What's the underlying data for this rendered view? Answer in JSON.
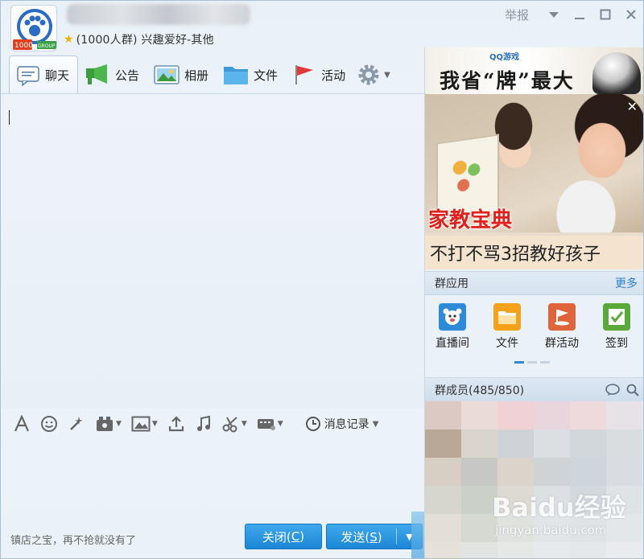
{
  "header": {
    "subtitle": "(1000人群) 兴趣爱好-其他",
    "report_label": "举报",
    "avatar_badge": "1000",
    "avatar_ribbon": "GROUP"
  },
  "tabs": [
    {
      "label": "聊天",
      "icon": "chat-bubble-icon",
      "active": true
    },
    {
      "label": "公告",
      "icon": "megaphone-icon",
      "active": false
    },
    {
      "label": "相册",
      "icon": "photo-icon",
      "active": false
    },
    {
      "label": "文件",
      "icon": "folder-icon",
      "active": false
    },
    {
      "label": "活动",
      "icon": "flag-icon",
      "active": false
    }
  ],
  "toolbar": {
    "history_label": "消息记录"
  },
  "footer": {
    "note": "镇店之宝，再不抢就没有了",
    "close_label": "关闭(",
    "close_key": "C",
    "close_tail": ")",
    "send_label": "发送(",
    "send_key": "S",
    "send_tail": ")"
  },
  "ads": {
    "top_logo": "QQ游戏",
    "top_text": "我省“牌”最大",
    "main_title": "家教宝典",
    "main_sub": "不打不骂3招教好孩子"
  },
  "apps": {
    "title": "群应用",
    "more": "更多",
    "items": [
      {
        "label": "直播间",
        "icon": "live-room-icon",
        "color": "#2f8ad8"
      },
      {
        "label": "文件",
        "icon": "folder-icon",
        "color": "#f5a21a"
      },
      {
        "label": "群活动",
        "icon": "group-activity-icon",
        "color": "#e0643a"
      },
      {
        "label": "签到",
        "icon": "checkin-icon",
        "color": "#5aa83a"
      }
    ]
  },
  "members": {
    "title": "群成员(485/850)"
  },
  "watermark": {
    "brand": "Baidu经验",
    "url": "jingyan.baidu.com"
  },
  "colors": {
    "accent": "#2b80d0",
    "send_button": "#1b86d6",
    "ad_title": "#e0201c"
  }
}
